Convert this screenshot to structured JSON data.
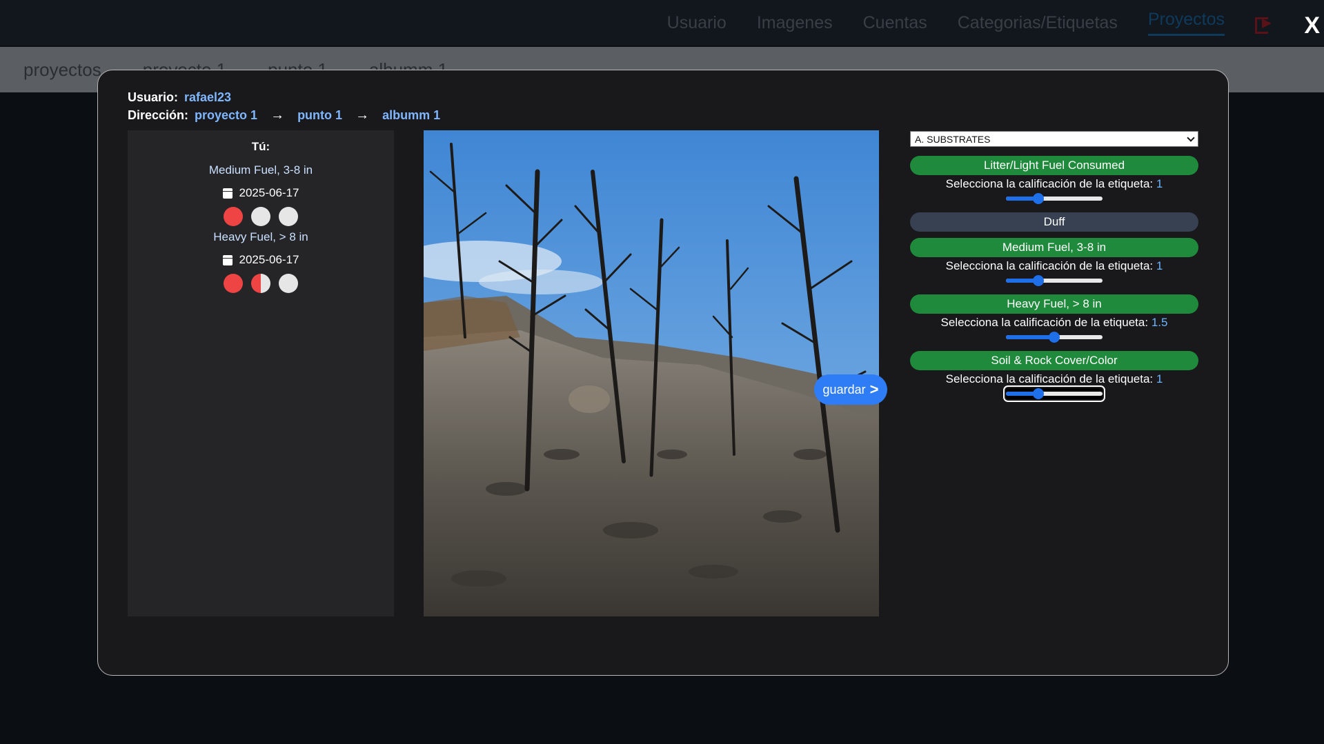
{
  "topnav": {
    "items": [
      "Usuario",
      "Imagenes",
      "Cuentas",
      "Categorias/Etiquetas",
      "Proyectos"
    ],
    "active": "Proyectos",
    "close_label": "X"
  },
  "breadcrumb_bg": [
    "proyectos",
    "proyecto 1",
    "punto 1",
    "albumm 1"
  ],
  "modal": {
    "user_label": "Usuario:",
    "user_value": "rafael23",
    "path_label": "Dirección:",
    "path": [
      "proyecto 1",
      "punto 1",
      "albumm 1"
    ],
    "arrow": "→"
  },
  "left": {
    "title": "Tú:",
    "entries": [
      {
        "tag": "Medium Fuel, 3-8 in",
        "date": "2025-06-17",
        "rating": 1
      },
      {
        "tag": "Heavy Fuel, > 8 in",
        "date": "2025-06-17",
        "rating": 1.5
      }
    ]
  },
  "photo": {
    "alt": "burned-forest-photo"
  },
  "save_button": {
    "label": "guardar",
    "chevron": ">"
  },
  "right": {
    "select_value": "A. SUBSTRATES",
    "rating_prompt": "Selecciona la calificación de la etiqueta:",
    "slider_max": 3,
    "tags": [
      {
        "name": "Litter/Light Fuel Consumed",
        "active": true,
        "rating": "1"
      },
      {
        "name": "Duff",
        "active": false,
        "rating": null
      },
      {
        "name": "Medium Fuel, 3-8 in",
        "active": true,
        "rating": "1"
      },
      {
        "name": "Heavy Fuel, > 8 in",
        "active": true,
        "rating": "1.5"
      },
      {
        "name": "Soil & Rock Cover/Color",
        "active": true,
        "rating": "1"
      }
    ]
  },
  "colors": {
    "active_tag": "#1f8a3b",
    "inactive_tag": "#374151",
    "accent": "#2f7df6",
    "rating_red": "#ef4444",
    "link": "#7fb6ff"
  }
}
